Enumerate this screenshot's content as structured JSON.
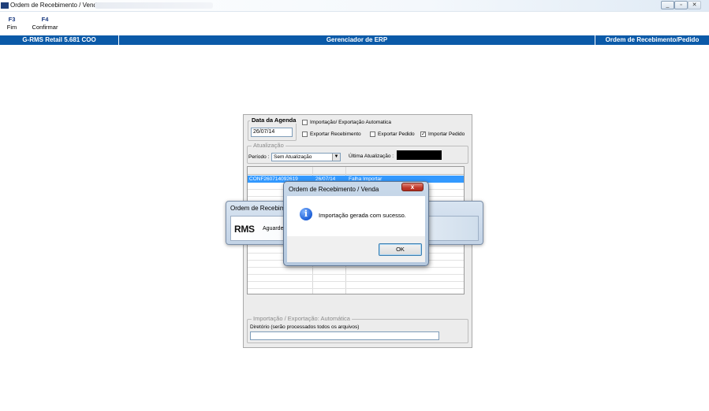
{
  "window": {
    "title": "Ordem de Recebimento / Venda",
    "controls": [
      "minimize",
      "maximize",
      "close"
    ]
  },
  "toolbar": {
    "items": [
      {
        "key": "F3",
        "label": "Fim"
      },
      {
        "key": "F4",
        "label": "Confirmar"
      }
    ]
  },
  "header_band": {
    "left": "G-RMS Retail 5.681 COO",
    "center": "Gerenciador de ERP",
    "right": "Ordem de Recebimento/Pedido",
    "color": "#0b5aa8"
  },
  "form": {
    "data_agenda": {
      "legend": "Data da Agenda",
      "value": "26/07/14"
    },
    "checkboxes": {
      "auto": {
        "label": "Importação/ Exportação Automatica",
        "checked": false
      },
      "exportar_recebimento": {
        "label": "Exportar Recebimento",
        "checked": false
      },
      "exportar_pedido": {
        "label": "Exportar Pedido",
        "checked": false
      },
      "importar_pedido": {
        "label": "Importar Pedido",
        "checked": true
      }
    },
    "atualizacao": {
      "legend": "Atualização",
      "periodo_label": "Período :",
      "periodo_value": "Sem Atualização",
      "ultima_label": "Última Atualização :"
    },
    "grid": {
      "selected_row": {
        "id": "CONF260714092619",
        "date": "26/07/14",
        "status": "Falha Importar"
      }
    },
    "auto_section": {
      "legend": "Importação / Exportação: Automática",
      "dir_label": "Diretório (serão processados todos os arquivos)",
      "dir_value": ""
    }
  },
  "progress_dialog": {
    "title": "Ordem de Recebime",
    "logo": "RMS",
    "text": "Aguarde,"
  },
  "message_box": {
    "title": "Ordem de Recebimento / Venda",
    "close": "x",
    "icon": "info-icon",
    "message": "Importação gerada com sucesso.",
    "ok_label": "OK"
  }
}
